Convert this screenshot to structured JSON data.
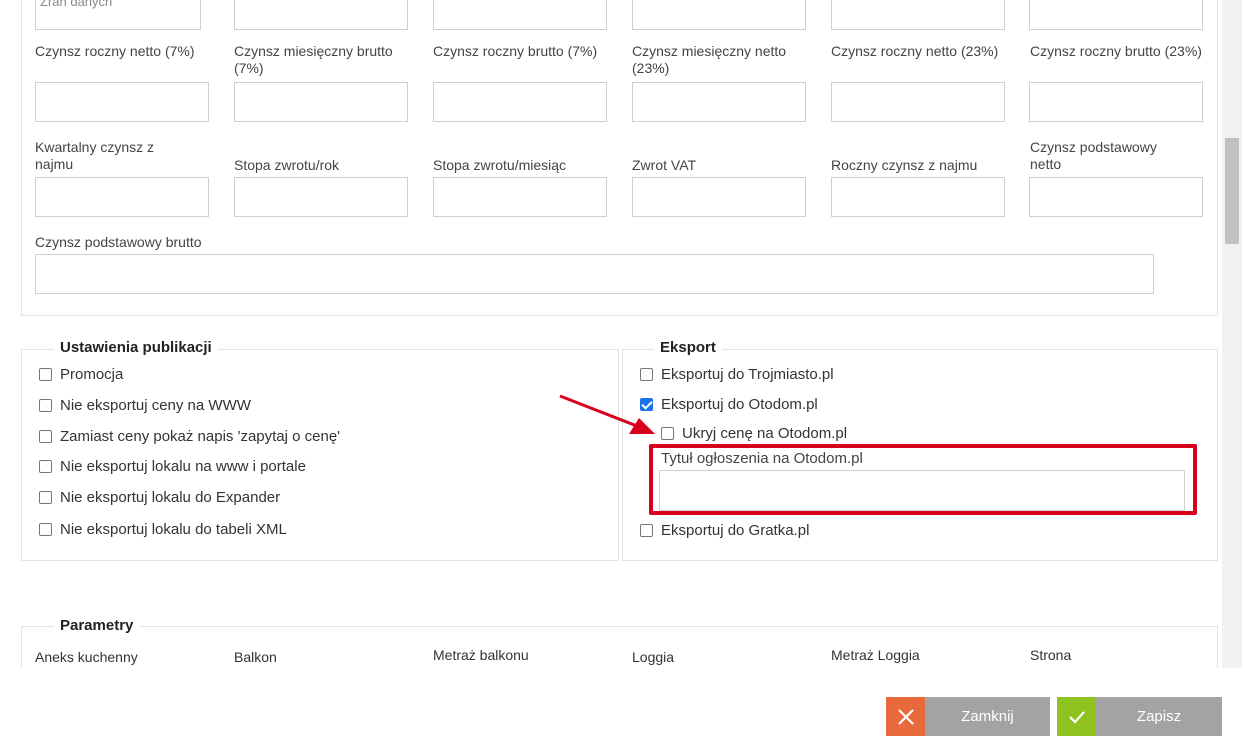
{
  "top_partial_label": "Zran danych",
  "rent_fields": {
    "row1": [
      "Czynsz roczny netto (7%)",
      "Czynsz miesięczny brutto (7%)",
      "Czynsz roczny brutto (7%)",
      "Czynsz miesięczny netto (23%)",
      "Czynsz roczny netto (23%)",
      "Czynsz roczny brutto (23%)"
    ],
    "row2": [
      "Kwartalny czynsz z najmu",
      "Stopa zwrotu/rok",
      "Stopa zwrotu/miesiąc",
      "Zwrot VAT",
      "Roczny czynsz z najmu",
      "Czynsz podstawowy netto"
    ],
    "wide_label": "Czynsz podstawowy brutto"
  },
  "publication": {
    "legend": "Ustawienia publikacji",
    "items": [
      {
        "label": "Promocja",
        "checked": false
      },
      {
        "label": "Nie eksportuj ceny na WWW",
        "checked": false
      },
      {
        "label": "Zamiast ceny pokaż napis 'zapytaj o cenę'",
        "checked": false
      },
      {
        "label": "Nie eksportuj lokalu na www i portale",
        "checked": false
      },
      {
        "label": "Nie eksportuj lokalu do Expander",
        "checked": false
      },
      {
        "label": "Nie eksportuj lokalu do tabeli XML",
        "checked": false
      }
    ]
  },
  "export": {
    "legend": "Eksport",
    "trojmiasto": {
      "label": "Eksportuj do Trojmiasto.pl",
      "checked": false
    },
    "otodom": {
      "label": "Eksportuj do Otodom.pl",
      "checked": true
    },
    "hide_price": {
      "label": "Ukryj cenę na Otodom.pl",
      "checked": false
    },
    "title_field_label": "Tytuł ogłoszenia na Otodom.pl",
    "title_field_value": "",
    "gratka": {
      "label": "Eksportuj do Gratka.pl",
      "checked": false
    }
  },
  "parameters": {
    "legend": "Parametry",
    "columns": [
      "Aneks kuchenny",
      "Balkon",
      "Metraż balkonu",
      "Loggia",
      "Metraż Loggia",
      "Strona"
    ]
  },
  "footer": {
    "close_label": "Zamknij",
    "save_label": "Zapisz",
    "close_color": "#e8693b",
    "save_color": "#8dc21f"
  },
  "highlight_color": "#d9001b"
}
